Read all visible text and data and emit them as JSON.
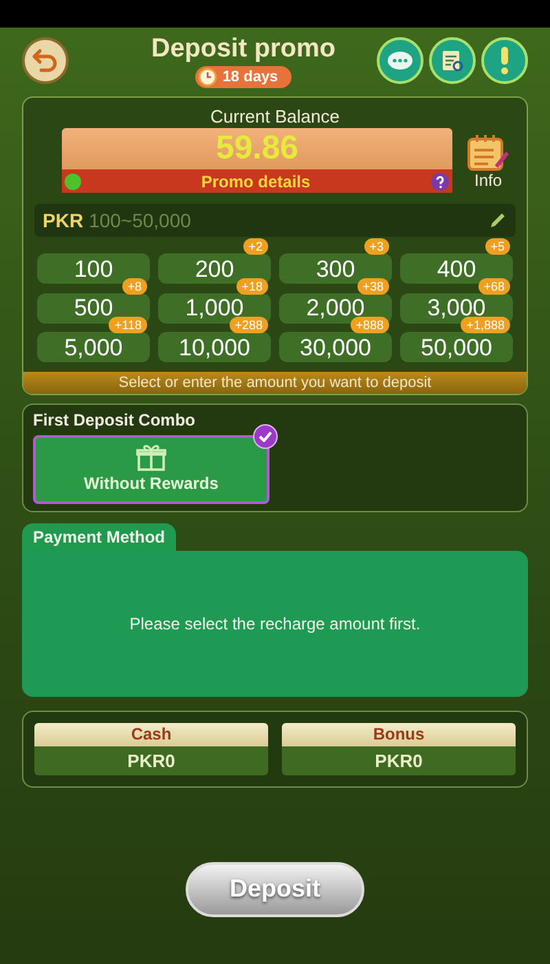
{
  "header": {
    "title": "Deposit promo",
    "countdown": "18 days"
  },
  "balance": {
    "label": "Current Balance",
    "amount": "59.86",
    "promo_link": "Promo details",
    "info_label": "Info"
  },
  "amount_field": {
    "currency": "PKR",
    "placeholder": "100~50,000"
  },
  "amounts": [
    {
      "amount": "100"
    },
    {
      "amount": "200",
      "bonus": "+2"
    },
    {
      "amount": "300",
      "bonus": "+3"
    },
    {
      "amount": "400",
      "bonus": "+5"
    },
    {
      "amount": "500",
      "bonus": "+8"
    },
    {
      "amount": "1,000",
      "bonus": "+18"
    },
    {
      "amount": "2,000",
      "bonus": "+38"
    },
    {
      "amount": "3,000",
      "bonus": "+68"
    },
    {
      "amount": "5,000",
      "bonus": "+118"
    },
    {
      "amount": "10,000",
      "bonus": "+288"
    },
    {
      "amount": "30,000",
      "bonus": "+888"
    },
    {
      "amount": "50,000",
      "bonus": "+1,888"
    }
  ],
  "amount_hint": "Select or enter the amount you want to deposit",
  "combo": {
    "title": "First Deposit Combo",
    "options": [
      {
        "label": "Without Rewards",
        "selected": true
      }
    ]
  },
  "payment": {
    "title": "Payment Method",
    "message": "Please select the recharge amount first."
  },
  "wallet": [
    {
      "label": "Cash",
      "value": "PKR0"
    },
    {
      "label": "Bonus",
      "value": "PKR0"
    }
  ],
  "deposit_button": "Deposit"
}
